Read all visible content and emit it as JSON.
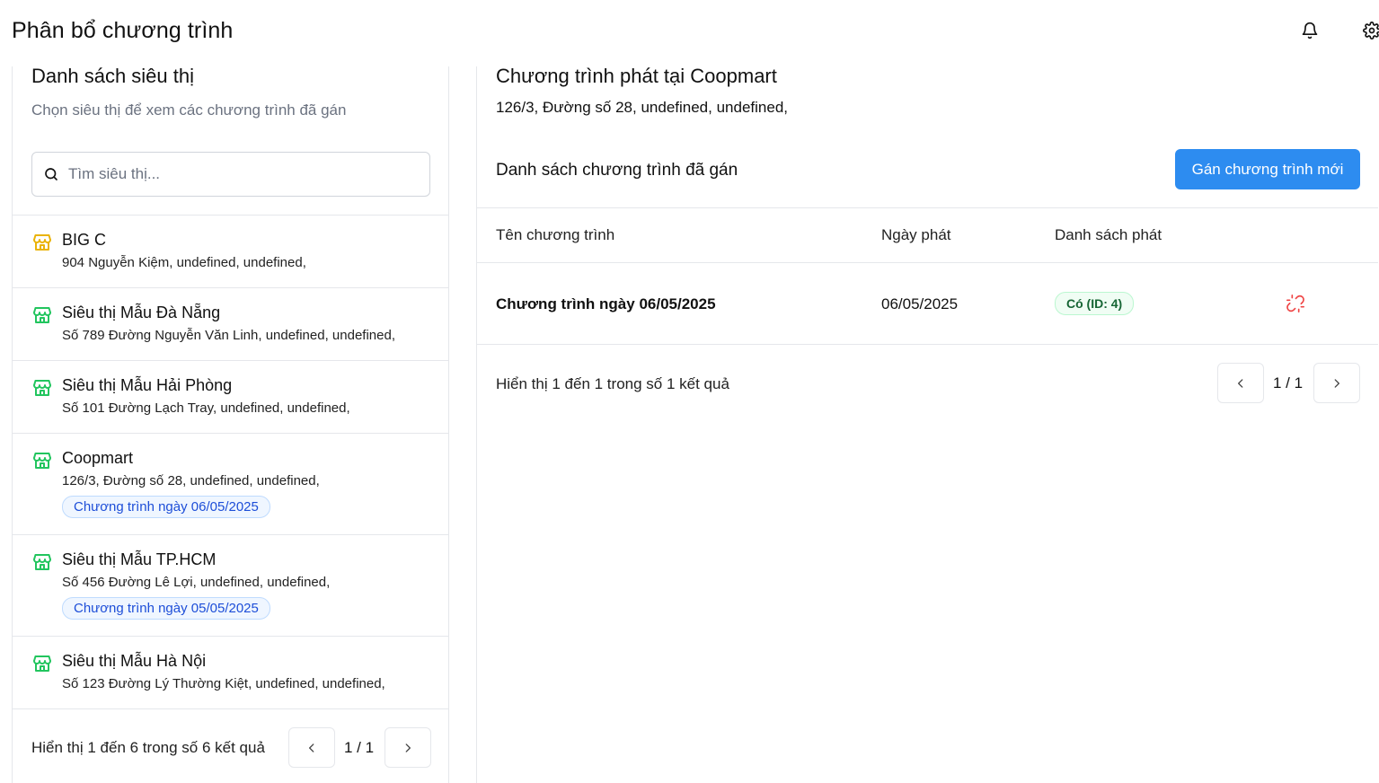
{
  "header": {
    "title": "Phân bổ chương trình",
    "icons": [
      "bell-icon",
      "gear-icon"
    ]
  },
  "left": {
    "title": "Danh sách siêu thị",
    "subtitle": "Chọn siêu thị để xem các chương trình đã gán",
    "search_placeholder": "Tìm siêu thị...",
    "stores": [
      {
        "name": "BIG C",
        "address": "904 Nguyễn Kiệm, undefined, undefined,",
        "tag": "",
        "icon_color": "#eab308"
      },
      {
        "name": "Siêu thị Mẫu Đà Nẵng",
        "address": "Số 789 Đường Nguyễn Văn Linh, undefined, undefined,",
        "tag": "",
        "icon_color": "#22c55e"
      },
      {
        "name": "Siêu thị Mẫu Hải Phòng",
        "address": "Số 101 Đường Lạch Tray, undefined, undefined,",
        "tag": "",
        "icon_color": "#22c55e"
      },
      {
        "name": "Coopmart",
        "address": "126/3, Đường số 28, undefined, undefined,",
        "tag": "Chương trình ngày 06/05/2025",
        "icon_color": "#22c55e"
      },
      {
        "name": "Siêu thị Mẫu TP.HCM",
        "address": "Số 456 Đường Lê Lợi, undefined, undefined,",
        "tag": "Chương trình ngày 05/05/2025",
        "icon_color": "#22c55e"
      },
      {
        "name": "Siêu thị Mẫu Hà Nội",
        "address": "Số 123 Đường Lý Thường Kiệt, undefined, undefined,",
        "tag": "",
        "icon_color": "#22c55e"
      }
    ],
    "summary": "Hiển thị 1 đến 6 trong số 6 kết quả",
    "page": "1 / 1"
  },
  "right": {
    "title": "Chương trình phát tại Coopmart",
    "address": "126/3, Đường số 28, undefined, undefined,",
    "section_title": "Danh sách chương trình đã gán",
    "assign_label": "Gán chương trình mới",
    "columns": [
      "Tên chương trình",
      "Ngày phát",
      "Danh sách phát"
    ],
    "rows": [
      {
        "name": "Chương trình ngày 06/05/2025",
        "date": "06/05/2025",
        "status": "Có (ID: 4)"
      }
    ],
    "summary": "Hiển thị 1 đến 1 trong số 1 kết quả",
    "page": "1 / 1"
  },
  "colors": {
    "primary": "#2d8cf0",
    "store_icon_default": "#22c55e",
    "store_icon_highlight": "#eab308",
    "danger": "#ef4444"
  }
}
